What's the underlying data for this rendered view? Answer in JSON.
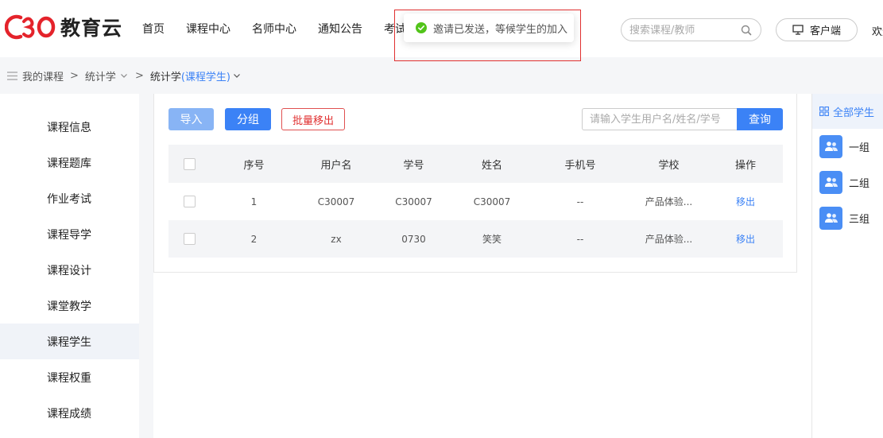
{
  "header": {
    "logo_mark": "C30",
    "logo_text": "教育云",
    "nav": [
      "首页",
      "课程中心",
      "名师中心",
      "通知公告",
      "考试"
    ],
    "search_placeholder": "搜索课程/教师",
    "client_label": "客户端",
    "welcome": "欢迎"
  },
  "toast": {
    "message": "邀请已发送，等候学生的加入"
  },
  "breadcrumb": {
    "root": "我的课程",
    "sep": ">",
    "course": "统计学",
    "current_prefix": "统计学",
    "current_highlight": "(课程学生)"
  },
  "sidebar": {
    "items": [
      {
        "label": "课程信息"
      },
      {
        "label": "课程题库"
      },
      {
        "label": "作业考试"
      },
      {
        "label": "课程导学"
      },
      {
        "label": "课程设计"
      },
      {
        "label": "课堂教学"
      },
      {
        "label": "课程学生",
        "active": true
      },
      {
        "label": "课程权重"
      },
      {
        "label": "课程成绩"
      }
    ]
  },
  "toolbar": {
    "import_label": "导入",
    "group_label": "分组",
    "batch_remove_label": "批量移出",
    "query_placeholder": "请输入学生用户名/姓名/学号",
    "query_label": "查询"
  },
  "table": {
    "headers": [
      "序号",
      "用户名",
      "学号",
      "姓名",
      "手机号",
      "学校",
      "操作"
    ],
    "rows": [
      {
        "index": "1",
        "username": "C30007",
        "student_no": "C30007",
        "name": "C30007",
        "phone": "--",
        "school": "产品体验...",
        "action": "移出"
      },
      {
        "index": "2",
        "username": "zx",
        "student_no": "0730",
        "name": "笑笑",
        "phone": "--",
        "school": "产品体验...",
        "action": "移出"
      }
    ]
  },
  "groups": {
    "all_label": "全部学生",
    "items": [
      {
        "label": "一组"
      },
      {
        "label": "二组"
      },
      {
        "label": "三组"
      }
    ]
  },
  "colors": {
    "accent": "#3b82f6",
    "danger": "#e03030",
    "logo_red": "#e4232b",
    "success": "#52c41a"
  }
}
